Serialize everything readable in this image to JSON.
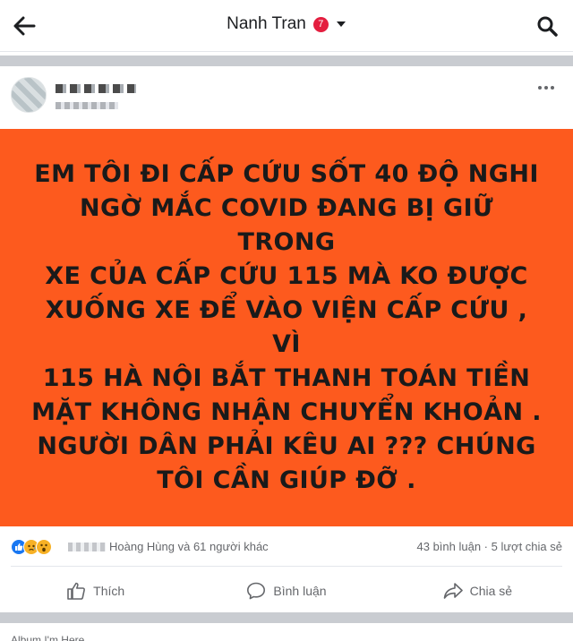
{
  "header": {
    "title": "Nanh Tran",
    "badge": "7",
    "back_icon": "arrow-left-icon",
    "caret_icon": "caret-down-icon",
    "search_icon": "search-icon"
  },
  "post": {
    "more_icon": "more-horizontal-icon",
    "background_color": "#fd5a1e",
    "text": "EM TÔI ĐI CẤP CỨU SỐT 40 ĐỘ NGHI\nNGỜ MẮC COVID ĐANG BỊ GIỮ TRONG\nXE CỦA CẤP CỨU 115  MÀ KO ĐƯỢC\nXUỐNG XE ĐỂ VÀO VIỆN CẤP CỨU ,  VÌ\n115 HÀ NỘI BẮT THANH TOÁN TIỀN\nMẶT KHÔNG NHẬN CHUYỂN KHOẢN .\nNGƯỜI DÂN PHẢI KÊU AI ??? CHÚNG\nTÔI CẦN GIÚP ĐỠ ."
  },
  "reactions": {
    "icons": [
      "like-reaction-icon",
      "sad-reaction-icon",
      "wow-reaction-icon"
    ],
    "names": "Hoàng Hùng và 61 người khác",
    "counts": "43 bình luận · 5 lượt chia sẻ"
  },
  "actions": {
    "like": "Thích",
    "comment": "Bình luận",
    "share": "Chia sẻ"
  },
  "next_post": {
    "label": "Album I'm Here"
  }
}
